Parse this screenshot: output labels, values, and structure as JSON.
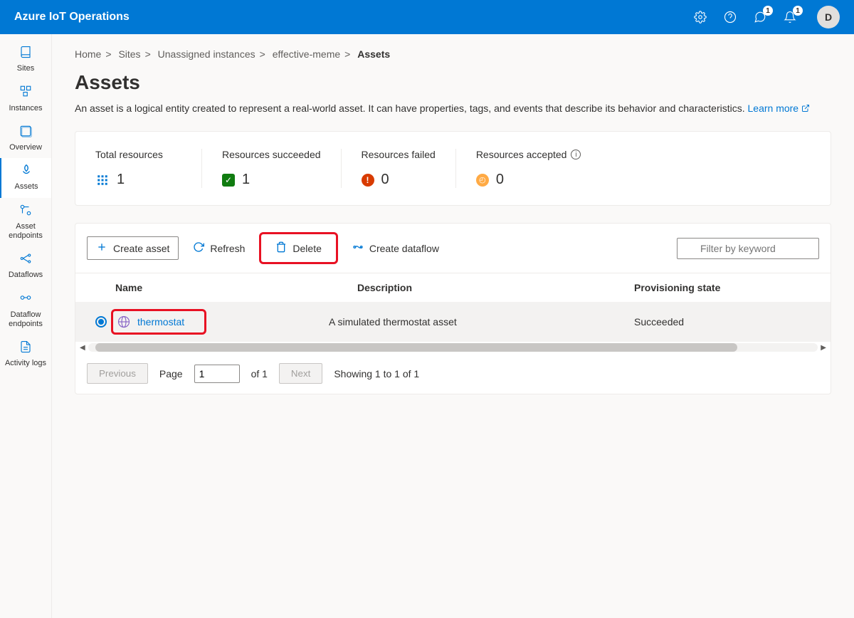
{
  "header": {
    "title": "Azure IoT Operations",
    "feedback_badge": "1",
    "notification_badge": "1",
    "avatar_initial": "D"
  },
  "sidebar": {
    "items": [
      {
        "label": "Sites"
      },
      {
        "label": "Instances"
      },
      {
        "label": "Overview"
      },
      {
        "label": "Assets"
      },
      {
        "label": "Asset endpoints"
      },
      {
        "label": "Dataflows"
      },
      {
        "label": "Dataflow endpoints"
      },
      {
        "label": "Activity logs"
      }
    ]
  },
  "breadcrumb": {
    "items": [
      "Home",
      "Sites",
      "Unassigned instances",
      "effective-meme"
    ],
    "current": "Assets"
  },
  "page": {
    "title": "Assets",
    "description": "An asset is a logical entity created to represent a real-world asset. It can have properties, tags, and events that describe its behavior and characteristics.",
    "learn_more": "Learn more"
  },
  "stats": [
    {
      "label": "Total resources",
      "value": "1"
    },
    {
      "label": "Resources succeeded",
      "value": "1"
    },
    {
      "label": "Resources failed",
      "value": "0"
    },
    {
      "label": "Resources accepted",
      "value": "0"
    }
  ],
  "toolbar": {
    "create": "Create asset",
    "refresh": "Refresh",
    "delete": "Delete",
    "dataflow": "Create dataflow",
    "filter_placeholder": "Filter by keyword"
  },
  "table": {
    "columns": {
      "name": "Name",
      "description": "Description",
      "state": "Provisioning state"
    },
    "rows": [
      {
        "name": "thermostat",
        "description": "A simulated thermostat asset",
        "state": "Succeeded",
        "selected": true
      }
    ]
  },
  "pagination": {
    "previous": "Previous",
    "next": "Next",
    "page_label": "Page",
    "page_value": "1",
    "of_text": "of 1",
    "showing": "Showing 1 to 1 of 1"
  }
}
